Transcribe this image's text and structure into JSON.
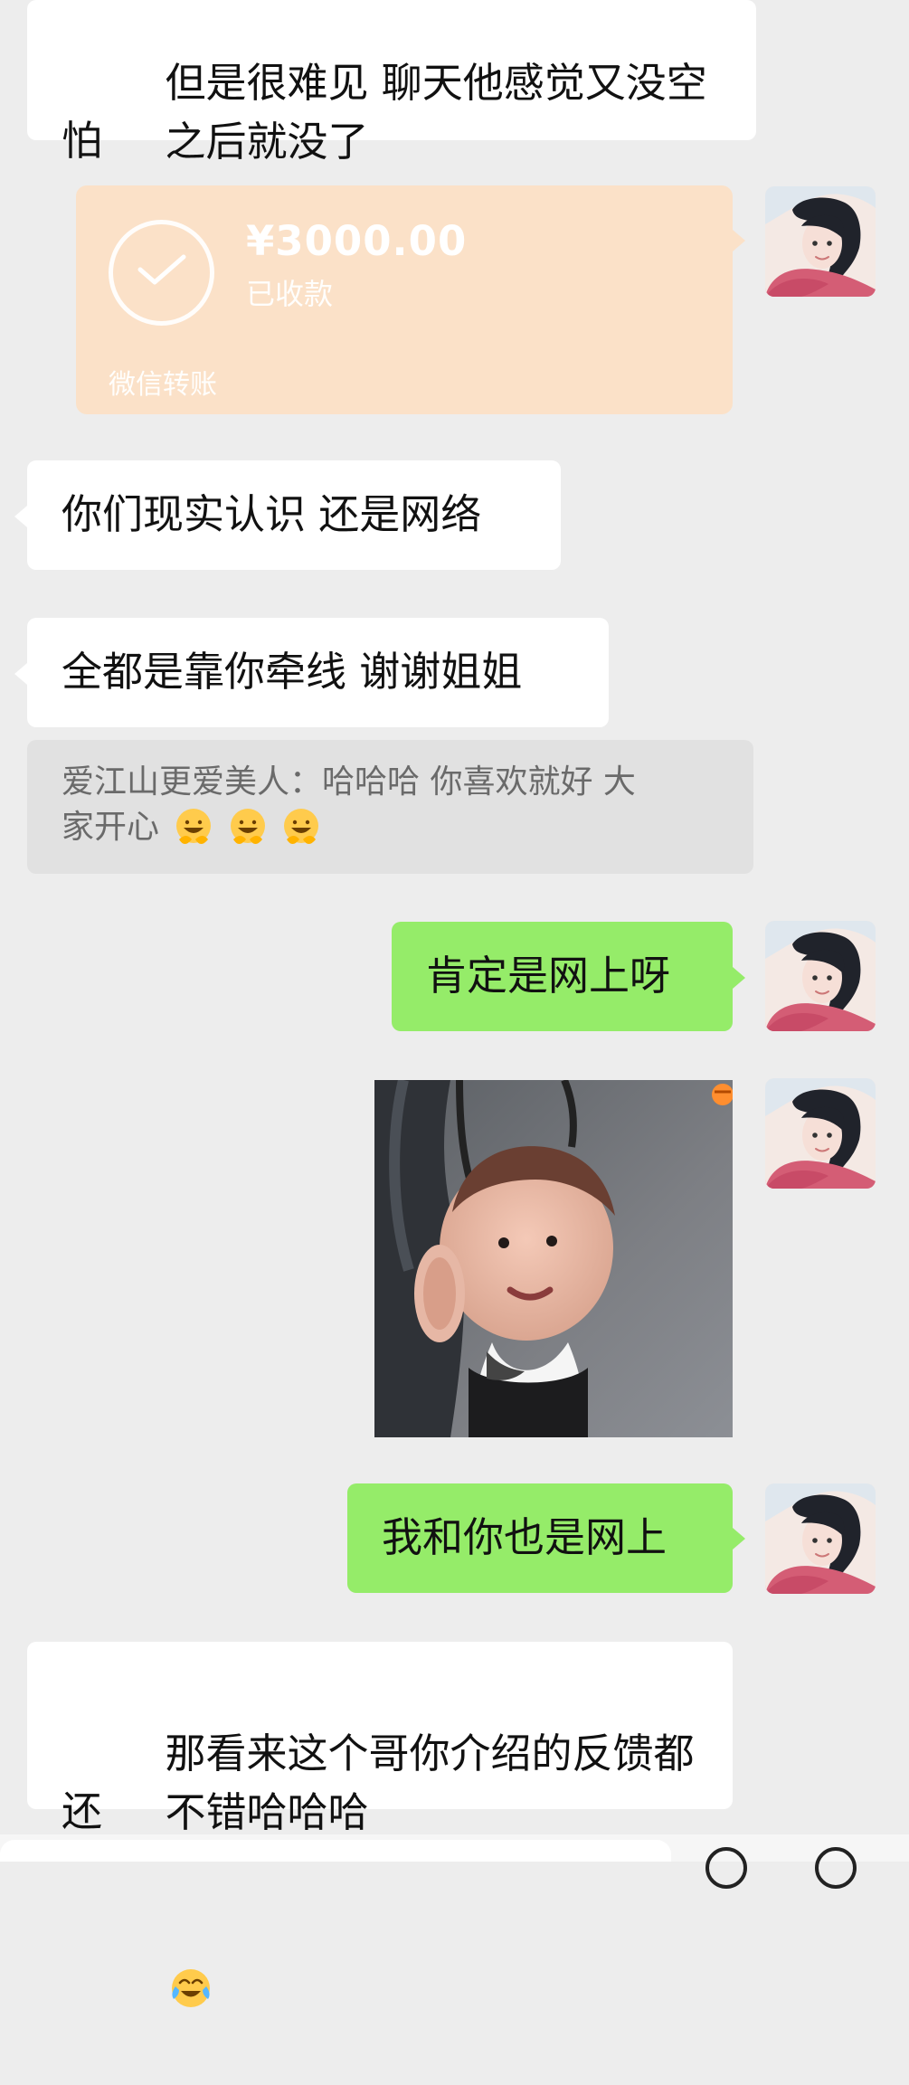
{
  "messages": {
    "m1": {
      "line1": "但是很难见 聊天他感觉又没空 怕",
      "line2": "之后就没了"
    },
    "transfer": {
      "amount": "¥3000.00",
      "status": "已收款",
      "source": "微信转账"
    },
    "m2": {
      "text": "你们现实认识 还是网络"
    },
    "m3": {
      "text": "全都是靠你牵线 谢谢姐姐"
    },
    "quote": {
      "line1": "爱江山更爱美人：哈哈哈 你喜欢就好 大",
      "line2": "家开心"
    },
    "m4": {
      "text": "肯定是网上呀"
    },
    "m5": {
      "text": "我和你也是网上"
    },
    "m6": {
      "line1": "那看来这个哥你介绍的反馈都还",
      "line2": "不错哈哈哈"
    }
  },
  "colors": {
    "background": "#ededed",
    "incoming_bubble": "#ffffff",
    "outgoing_bubble": "#95ec69",
    "transfer_bubble": "#fbe1c8",
    "quote_bubble": "#e1e1e1"
  },
  "icons": {
    "disappointed_face": "disappointed-face-icon",
    "smile_face": "smiling-face-icon",
    "tears_of_joy": "tears-of-joy-icon",
    "check": "check-icon"
  }
}
